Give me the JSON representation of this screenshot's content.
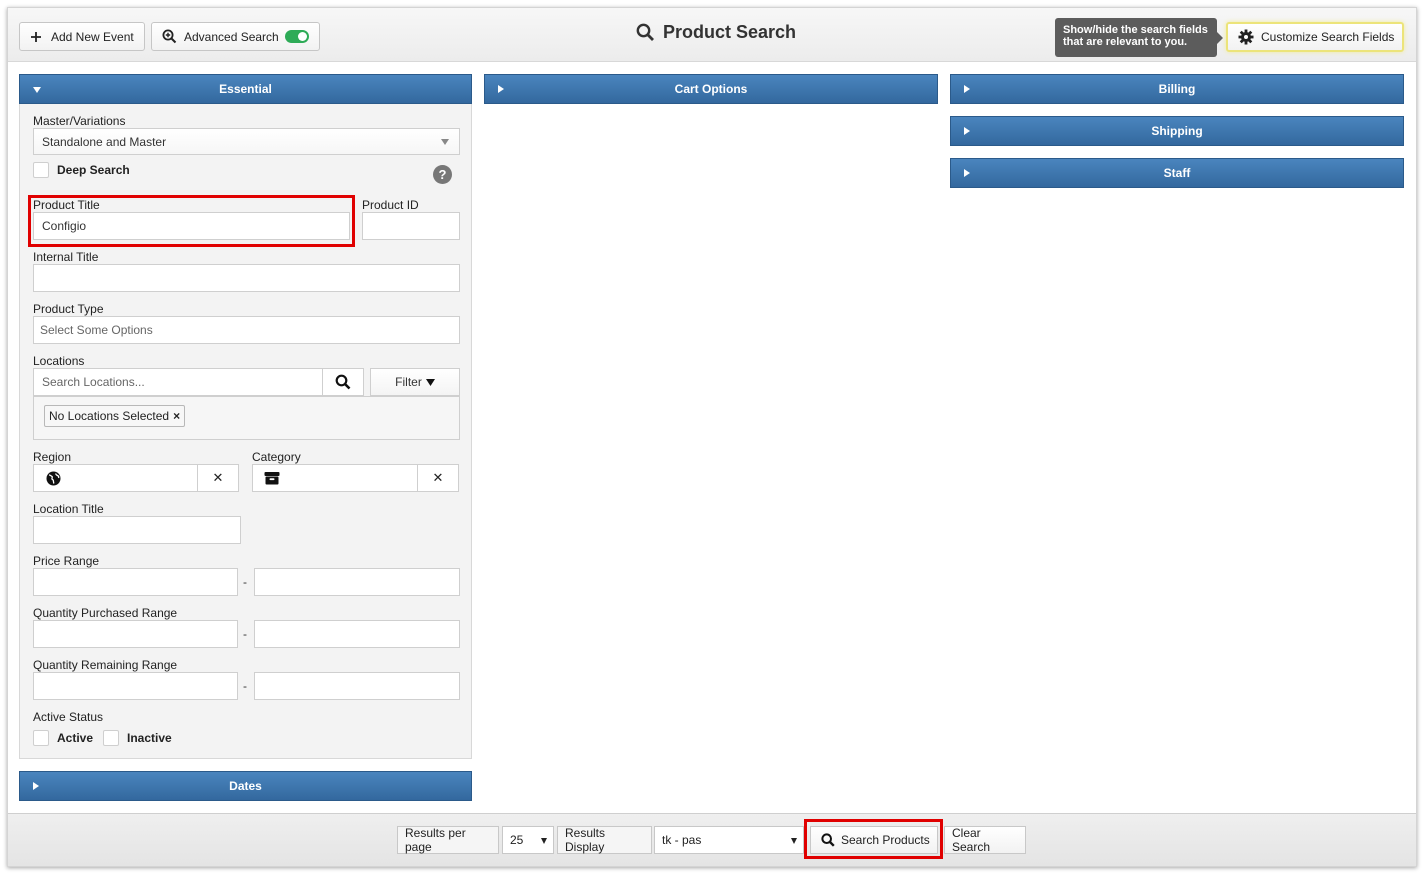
{
  "header": {
    "add_event_label": "Add New Event",
    "advanced_search_label": "Advanced Search",
    "advanced_search_enabled": true,
    "page_title": "Product Search",
    "tooltip_line1": "Show/hide the search fields",
    "tooltip_line2": "that are relevant to you.",
    "customize_label": "Customize Search Fields"
  },
  "panels": {
    "essential": "Essential",
    "cart_options": "Cart Options",
    "billing": "Billing",
    "shipping": "Shipping",
    "staff": "Staff",
    "dates": "Dates"
  },
  "essential": {
    "master_variations_label": "Master/Variations",
    "master_variations_value": "Standalone and Master",
    "deep_search_label": "Deep Search",
    "help_glyph": "?",
    "product_title_label": "Product Title",
    "product_title_value": "Configio",
    "product_id_label": "Product ID",
    "product_id_value": "",
    "internal_title_label": "Internal Title",
    "internal_title_value": "",
    "product_type_label": "Product Type",
    "product_type_placeholder": "Select Some Options",
    "locations_label": "Locations",
    "locations_placeholder": "Search Locations...",
    "filter_label": "Filter",
    "no_locations_tag": "No Locations Selected",
    "tag_remove": "×",
    "region_label": "Region",
    "category_label": "Category",
    "clear_glyph": "✕",
    "location_title_label": "Location Title",
    "price_range_label": "Price Range",
    "qty_purchased_label": "Quantity Purchased Range",
    "qty_remaining_label": "Quantity Remaining Range",
    "range_separator": "-",
    "active_status_label": "Active Status",
    "active_label": "Active",
    "inactive_label": "Inactive"
  },
  "footer": {
    "results_per_page_label": "Results per page",
    "results_per_page_value": "25",
    "results_display_label": "Results Display",
    "results_display_value": "tk - pas",
    "search_products_label": "Search Products",
    "clear_search_label": "Clear Search"
  },
  "colors": {
    "panel_header": "#3a72aa",
    "toggle_on": "#2eab57",
    "highlight": "#e00000"
  }
}
